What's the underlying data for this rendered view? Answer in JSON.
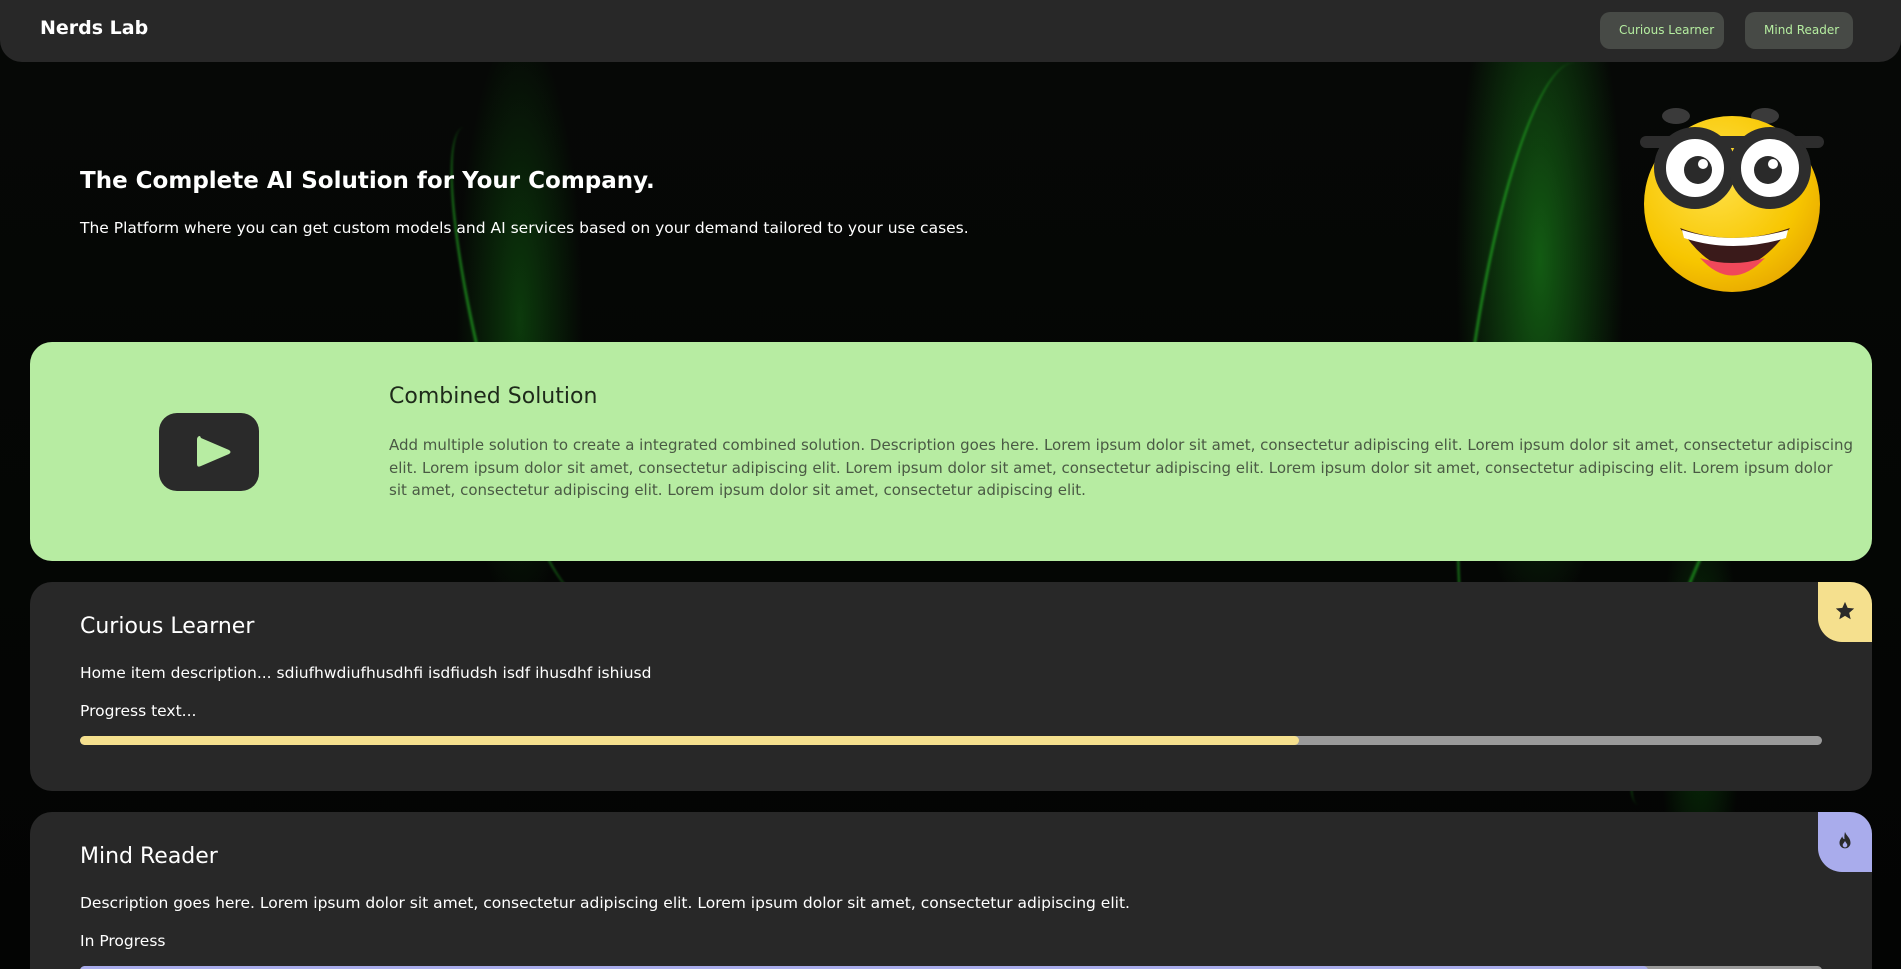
{
  "nav": {
    "brand": "Nerds Lab",
    "buttons": [
      "Curious Learner",
      "Mind Reader"
    ]
  },
  "hero": {
    "title": "The Complete AI Solution for Your Company.",
    "subtitle": "The Platform where you can get custom models and AI services based on your demand tailored to your use cases."
  },
  "combined": {
    "title": "Combined Solution",
    "description": "Add multiple solution to create a integrated combined solution. Description goes here. Lorem ipsum dolor sit amet, consectetur adipiscing elit. Lorem ipsum dolor sit amet, consectetur adipiscing elit. Lorem ipsum dolor sit amet, consectetur adipiscing elit. Lorem ipsum dolor sit amet, consectetur adipiscing elit. Lorem ipsum dolor sit amet, consectetur adipiscing elit. Lorem ipsum dolor sit amet, consectetur adipiscing elit. Lorem ipsum dolor sit amet, consectetur adipiscing elit.",
    "icon": "play-icon"
  },
  "cards": [
    {
      "title": "Curious Learner",
      "description": "Home item description... sdiufhwdiufhusdhfi isdfiudsh isdf ihusdhf ishiusd",
      "progress_text": "Progress text...",
      "progress": 0.7,
      "icon": "star-icon",
      "accent": "#f5e08e"
    },
    {
      "title": "Mind Reader",
      "description": "Description goes here. Lorem ipsum dolor sit amet, consectetur adipiscing elit. Lorem ipsum dolor sit amet, consectetur adipiscing elit.",
      "progress_text": "In Progress",
      "progress": 0.9,
      "icon": "flame-icon",
      "accent": "#a9acec"
    }
  ],
  "colors": {
    "background": "#050505",
    "surface": "#282828",
    "green_card": "#b7eca2",
    "nav_button_text": "#b5eda0",
    "track": "#9a9a9a"
  }
}
